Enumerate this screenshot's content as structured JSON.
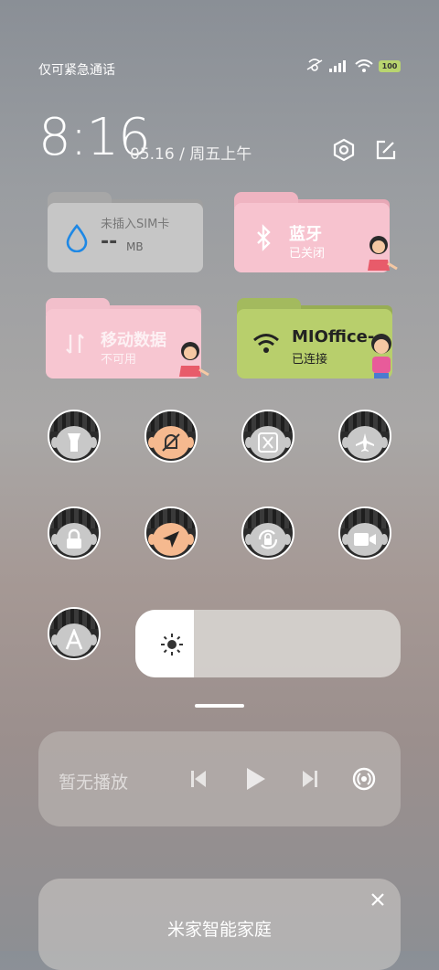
{
  "status": {
    "carrier": "仅可紧急通话",
    "battery": "100"
  },
  "clock": {
    "time": "8:16",
    "date": "05.16 / 周五上午"
  },
  "tiles": {
    "sim": {
      "title": "未插入SIM卡",
      "value": "--",
      "unit": "MB"
    },
    "bluetooth": {
      "title": "蓝牙",
      "status": "已关闭"
    },
    "mobile_data": {
      "title": "移动数据",
      "status": "不可用"
    },
    "wifi": {
      "title": "MIOffice-",
      "status": "已连接"
    }
  },
  "toggles": [
    {
      "name": "flashlight",
      "icon": "flashlight-icon",
      "active": false
    },
    {
      "name": "mute",
      "icon": "bell-off-icon",
      "active": true
    },
    {
      "name": "screenshot",
      "icon": "scissors-icon",
      "active": false
    },
    {
      "name": "airplane",
      "icon": "airplane-icon",
      "active": false
    },
    {
      "name": "lock",
      "icon": "lock-icon",
      "active": false
    },
    {
      "name": "location",
      "icon": "location-arrow-icon",
      "active": true
    },
    {
      "name": "auto-rotate",
      "icon": "rotate-lock-icon",
      "active": false
    },
    {
      "name": "screen-record",
      "icon": "video-camera-icon",
      "active": false
    },
    {
      "name": "auto-brightness",
      "icon": "letter-a-icon",
      "active": false
    }
  ],
  "brightness": {
    "level": 0.22
  },
  "media": {
    "label": "暂无播放"
  },
  "smart_home": {
    "title": "米家智能家庭"
  },
  "colors": {
    "pink_tile": "#f7c3cf",
    "green_tile": "#b8cf6c",
    "gray_tile": "#c9c9c9"
  }
}
